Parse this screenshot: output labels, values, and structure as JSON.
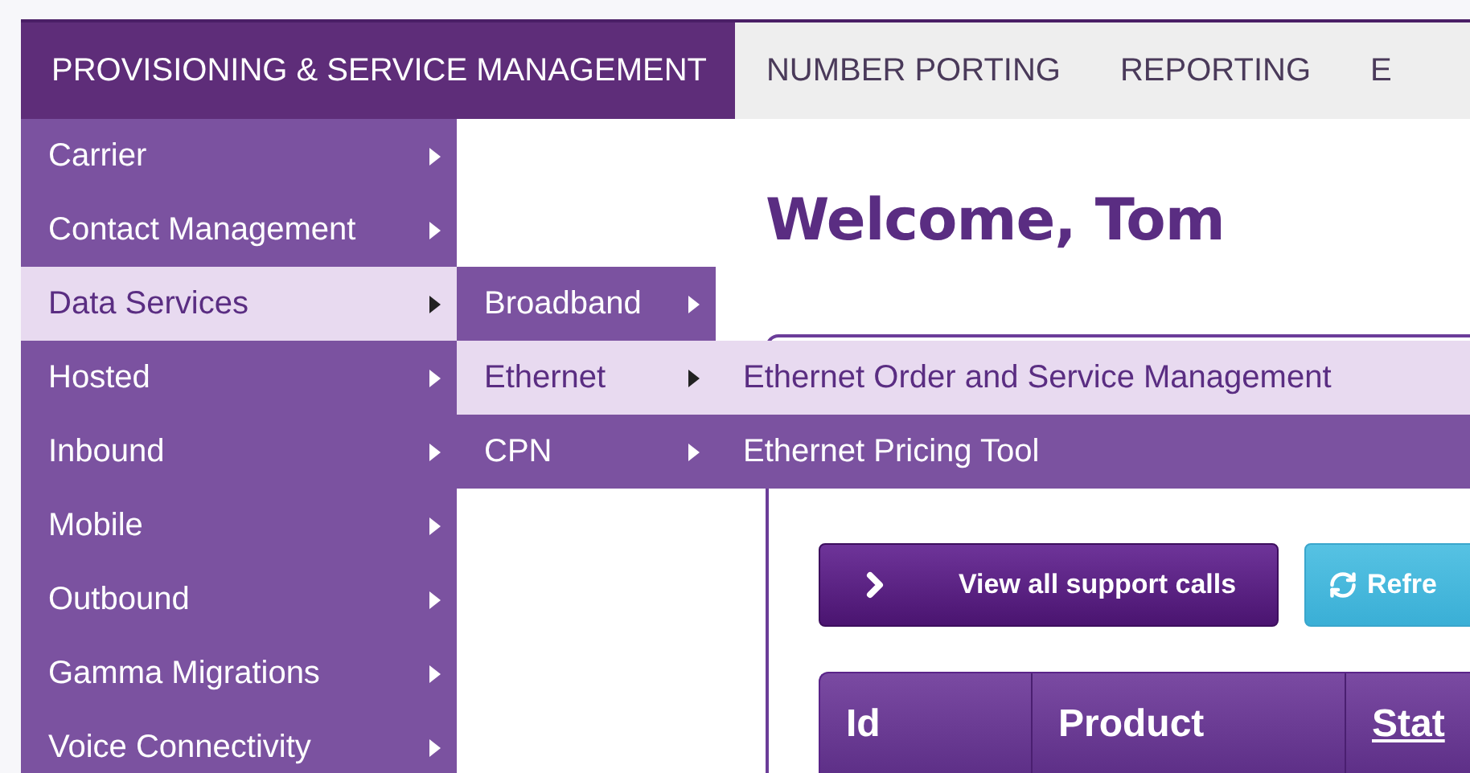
{
  "nav": {
    "tabs": [
      {
        "label": "PROVISIONING & SERVICE MANAGEMENT",
        "selected": true
      },
      {
        "label": "NUMBER PORTING",
        "selected": false
      },
      {
        "label": "REPORTING",
        "selected": false
      },
      {
        "label": "E",
        "selected": false
      }
    ]
  },
  "menu": {
    "items": [
      {
        "label": "Carrier",
        "selected": false
      },
      {
        "label": "Contact Management",
        "selected": false
      },
      {
        "label": "Data Services",
        "selected": true,
        "children": [
          {
            "label": "Broadband",
            "selected": false
          },
          {
            "label": "Ethernet",
            "selected": true,
            "children": [
              {
                "label": "Ethernet Order and Service Management",
                "selected": true
              },
              {
                "label": "Ethernet Pricing Tool",
                "selected": false
              }
            ]
          },
          {
            "label": "CPN",
            "selected": false
          }
        ]
      },
      {
        "label": "Hosted",
        "selected": false
      },
      {
        "label": "Inbound",
        "selected": false
      },
      {
        "label": "Mobile",
        "selected": false
      },
      {
        "label": "Outbound",
        "selected": false
      },
      {
        "label": "Gamma Migrations",
        "selected": false
      },
      {
        "label": "Voice Connectivity",
        "selected": false
      }
    ]
  },
  "welcome": "Welcome, Tom",
  "buttons": [
    {
      "kind": "primary",
      "label": "View all support calls"
    },
    {
      "kind": "refresh",
      "label": "Refre"
    }
  ],
  "table": {
    "columns": [
      {
        "label": "Id",
        "sortable": false
      },
      {
        "label": "Product",
        "sortable": false
      },
      {
        "label": "Stat",
        "sortable": true
      }
    ]
  }
}
